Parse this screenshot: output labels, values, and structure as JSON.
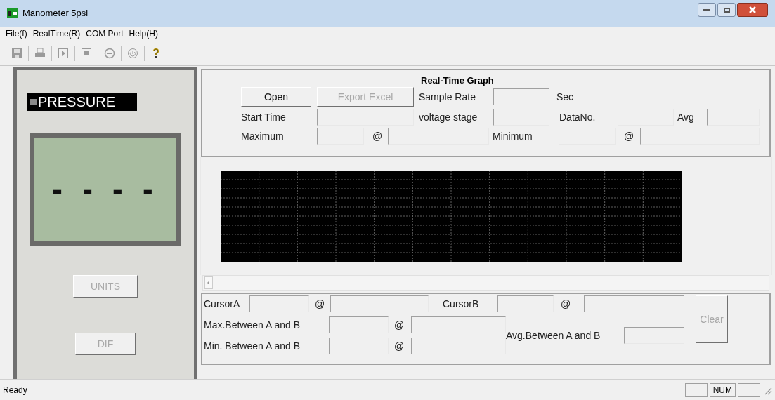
{
  "window": {
    "title": "Manometer 5psi"
  },
  "menu": [
    "File(f)",
    "RealTime(R)",
    "COM Port",
    "Help(H)"
  ],
  "toolbar": [
    {
      "kind": "save",
      "disabled": true
    },
    {
      "kind": "print",
      "disabled": true
    },
    {
      "kind": "play",
      "disabled": true
    },
    {
      "kind": "stop",
      "disabled": true
    },
    {
      "kind": "minus",
      "disabled": true
    },
    {
      "kind": "power",
      "disabled": true
    },
    {
      "kind": "help",
      "disabled": false
    }
  ],
  "display": {
    "label": "PRESSURE",
    "reading": "- - - -",
    "buttons": [
      {
        "label": "UNITS",
        "disabled": true
      },
      {
        "label": "DIF",
        "disabled": true
      }
    ]
  },
  "graph": {
    "title": "Real-Time Graph",
    "open": {
      "label": "Open",
      "disabled": false
    },
    "export": {
      "label": "Export Excel",
      "disabled": true
    },
    "sample_rate": "Sample Rate",
    "sec": "Sec",
    "start_time": "Start Time",
    "voltage_stage": "voltage stage",
    "data_no": "DataNo.",
    "avg": "Avg",
    "maximum": "Maximum",
    "at_max": "@",
    "minimum": "Minimum",
    "at_min": "@"
  },
  "cursors": {
    "cursor_a": "CursorA",
    "at_a": "@",
    "cursor_b": "CursorB",
    "at_b": "@",
    "max_between": "Max.Between A and B",
    "at_max": "@",
    "min_between": "Min. Between A and B",
    "at_min": "@",
    "avg_between": "Avg.Between A and B",
    "clear": {
      "label": "Clear",
      "disabled": true
    }
  },
  "status_bar": {
    "text": "Ready",
    "num": "NUM"
  }
}
